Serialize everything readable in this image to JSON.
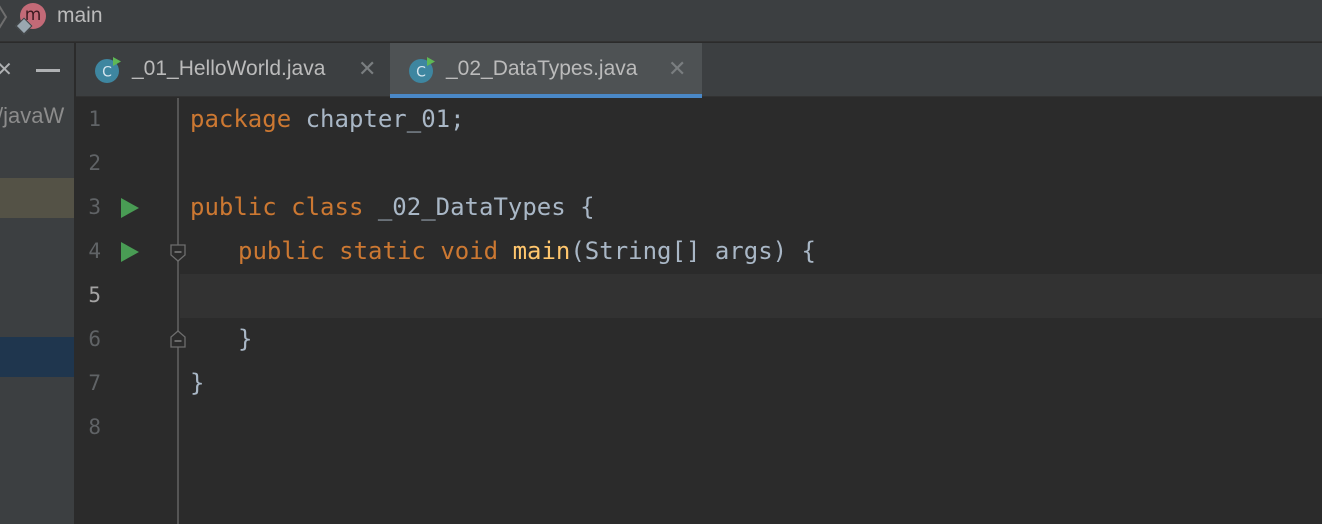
{
  "breadcrumb": {
    "method_badge": "m",
    "text": "main"
  },
  "project_pane": {
    "path_fragment": "/javaW"
  },
  "tabs": [
    {
      "label": "_01_HelloWorld.java",
      "icon_letter": "C",
      "active": false
    },
    {
      "label": "_02_DataTypes.java",
      "icon_letter": "C",
      "active": true
    }
  ],
  "editor": {
    "current_line": 5,
    "line_numbers": [
      "1",
      "2",
      "3",
      "4",
      "5",
      "6",
      "7",
      "8"
    ],
    "code": {
      "l1_kw": "package",
      "l1_rest": " chapter_01;",
      "l3_kw1": "public",
      "l3_kw2": "class",
      "l3_rest": " _02_DataTypes {",
      "l4_kw1": "public",
      "l4_kw2": "static",
      "l4_kw3": "void",
      "l4_fn": "main",
      "l4_rest": "(String[] args) {",
      "l6": "}",
      "l7": "}"
    }
  },
  "colors": {
    "keyword": "#cc7832",
    "function": "#ffc66d",
    "identifier": "#a9b7c6",
    "run_icon": "#499c54",
    "active_tab_underline": "#4a88c7"
  },
  "icons": {
    "tab_file": "java-class-icon",
    "run": "run-gutter-icon",
    "fold": "fold-gutter-icon",
    "close": "close-icon"
  }
}
